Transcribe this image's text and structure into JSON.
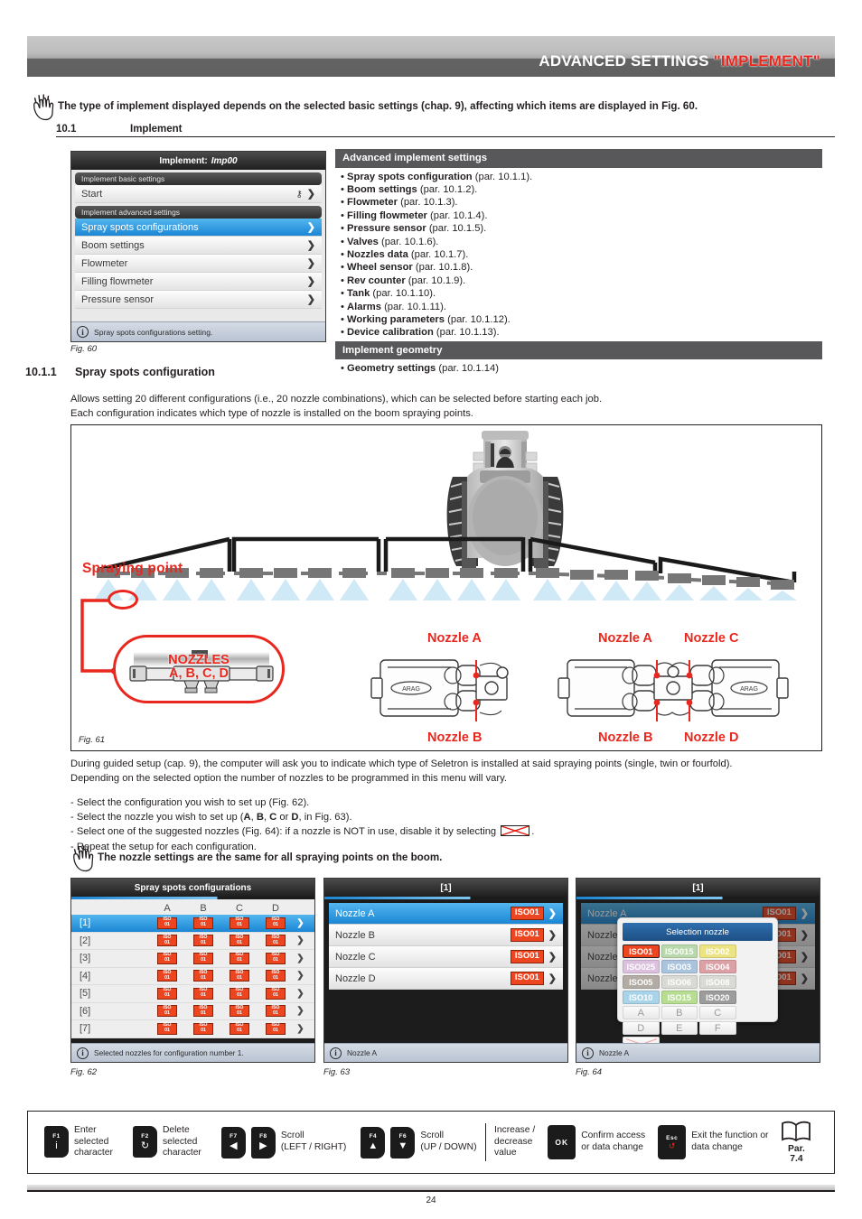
{
  "header": {
    "title_main": "ADVANCED SETTINGS ",
    "title_red": "\"IMPLEMENT\""
  },
  "note_top": "The type of implement displayed depends on the selected basic settings (chap. 9), affecting which items are displayed in Fig. 60.",
  "section_10_1": {
    "number": "10.1",
    "title": "Implement"
  },
  "section_10_1_1": {
    "number": "10.1.1",
    "title": "Spray spots configuration"
  },
  "intro": {
    "line1": "Allows setting 20 different configurations (i.e., 20 nozzle combinations), which can be selected before starting each job.",
    "line2": "Each configuration indicates which type of nozzle is installed on the boom spraying points."
  },
  "fig60": {
    "caption": "Fig. 60",
    "title_label": "Implement:",
    "title_value": "Imp00",
    "group1": "Implement basic settings",
    "start_row": "Start",
    "group2": "Implement advanced settings",
    "rows": [
      {
        "label": "Spray spots configurations",
        "selected": true
      },
      {
        "label": "Boom settings",
        "selected": false
      },
      {
        "label": "Flowmeter",
        "selected": false
      },
      {
        "label": "Filling flowmeter",
        "selected": false
      },
      {
        "label": "Pressure sensor",
        "selected": false
      }
    ],
    "info": "Spray spots configurations setting."
  },
  "advanced_panel": {
    "header": "Advanced implement settings",
    "items": [
      {
        "name": "Spray spots configuration",
        "par": " (par. 10.1.1)."
      },
      {
        "name": "Boom settings",
        "par": " (par. 10.1.2)."
      },
      {
        "name": "Flowmeter",
        "par": " (par. 10.1.3)."
      },
      {
        "name": "Filling flowmeter",
        "par": " (par. 10.1.4)."
      },
      {
        "name": "Pressure sensor",
        "par": " (par. 10.1.5)."
      },
      {
        "name": "Valves",
        "par": " (par. 10.1.6)."
      },
      {
        "name": "Nozzles data",
        "par": " (par. 10.1.7)."
      },
      {
        "name": "Wheel sensor",
        "par": " (par. 10.1.8)."
      },
      {
        "name": "Rev counter",
        "par": " (par. 10.1.9)."
      },
      {
        "name": "Tank",
        "par": " (par. 10.1.10)."
      },
      {
        "name": "Alarms",
        "par": " (par. 10.1.11)."
      },
      {
        "name": "Working parameters",
        "par": " (par. 10.1.12)."
      },
      {
        "name": "Device calibration",
        "par": " (par. 10.1.13)."
      }
    ],
    "geometry_header": "Implement geometry",
    "geometry_items": [
      {
        "name": "Geometry settings",
        "par": " (par. 10.1.14)"
      }
    ]
  },
  "fig61": {
    "caption": "Fig. 61",
    "spraying_point_label": "Spraying point",
    "bubble_line1": "NOZZLES",
    "bubble_line2": "A, B, C, D",
    "labels": {
      "single_top": "Nozzle A",
      "single_bottom": "Nozzle B",
      "four_top_left": "Nozzle A",
      "four_bottom_left": "Nozzle B",
      "four_top_right": "Nozzle C",
      "four_bottom_right": "Nozzle D"
    }
  },
  "during": {
    "line1": "During guided setup (cap. 9), the computer will ask you to indicate which type of Seletron is installed at said spraying points (single, twin or fourfold).",
    "line2": "Depending on the selected option the number of nozzles to be programmed in this menu will vary."
  },
  "steps": {
    "s1": "- Select the configuration you wish to set up (Fig. 62).",
    "s2_a": "- Select the nozzle you wish to set up (",
    "s2_A": "A",
    "s2_c1": ", ",
    "s2_B": "B",
    "s2_c2": ", ",
    "s2_C": "C",
    "s2_or": " or ",
    "s2_D": "D",
    "s2_b": ", in Fig. 63).",
    "s3_a": "- Select one of the suggested nozzles (Fig. 64): if a nozzle is NOT in use, disable it by selecting ",
    "s3_b": ".",
    "s4": "- Repeat the setup for each configuration."
  },
  "note_bottom": "The nozzle settings are the same for all spraying points on the boom.",
  "fig62": {
    "caption": "Fig. 62",
    "title": "Spray spots configurations",
    "columns": [
      "A",
      "B",
      "C",
      "D"
    ],
    "chip_top": "ISO",
    "chip_bottom": "01",
    "rows": [
      {
        "label": "[1]",
        "selected": true,
        "values": [
          "ISO01",
          "ISO01",
          "ISO01",
          "ISO01"
        ]
      },
      {
        "label": "[2]",
        "selected": false,
        "values": [
          "ISO01",
          "ISO01",
          "ISO01",
          "ISO01"
        ]
      },
      {
        "label": "[3]",
        "selected": false,
        "values": [
          "ISO01",
          "ISO01",
          "ISO01",
          "ISO01"
        ]
      },
      {
        "label": "[4]",
        "selected": false,
        "values": [
          "ISO01",
          "ISO01",
          "ISO01",
          "ISO01"
        ]
      },
      {
        "label": "[5]",
        "selected": false,
        "values": [
          "ISO01",
          "ISO01",
          "ISO01",
          "ISO01"
        ]
      },
      {
        "label": "[6]",
        "selected": false,
        "values": [
          "ISO01",
          "ISO01",
          "ISO01",
          "ISO01"
        ]
      },
      {
        "label": "[7]",
        "selected": false,
        "values": [
          "ISO01",
          "ISO01",
          "ISO01",
          "ISO01"
        ]
      }
    ],
    "info": "Selected nozzles for configuration number 1."
  },
  "fig63": {
    "caption": "Fig. 63",
    "title": "[1]",
    "rows": [
      {
        "label": "Nozzle A",
        "value": "ISO01",
        "selected": true
      },
      {
        "label": "Nozzle B",
        "value": "ISO01",
        "selected": false
      },
      {
        "label": "Nozzle C",
        "value": "ISO01",
        "selected": false
      },
      {
        "label": "Nozzle D",
        "value": "ISO01",
        "selected": false
      }
    ],
    "info": "Nozzle A"
  },
  "fig64": {
    "caption": "Fig. 64",
    "title": "[1]",
    "rows": [
      {
        "label": "Nozzle A",
        "value": "ISO01",
        "selected": true
      },
      {
        "label": "Nozzle B",
        "value": "ISO01",
        "selected": false
      },
      {
        "label": "Nozzle C",
        "value": "ISO01",
        "selected": false
      },
      {
        "label": "Nozzle D",
        "value": "ISO01",
        "selected": false
      }
    ],
    "dialog_title": "Selection nozzle",
    "nozzle_chips": [
      {
        "label": "ISO01",
        "bg": "#ee4521",
        "fg": "#ffffff",
        "selected": true
      },
      {
        "label": "ISO015",
        "bg": "#b9d9ac",
        "fg": "#ffffff",
        "selected": false
      },
      {
        "label": "ISO02",
        "bg": "#ece483",
        "fg": "#ffffff",
        "selected": false
      },
      {
        "label": "ISO025",
        "bg": "#dcc1de",
        "fg": "#ffffff",
        "selected": false
      },
      {
        "label": "ISO03",
        "bg": "#aac4dd",
        "fg": "#ffffff",
        "selected": false
      },
      {
        "label": "ISO04",
        "bg": "#dba1a6",
        "fg": "#ffffff",
        "selected": false
      },
      {
        "label": "ISO05",
        "bg": "#b3aca4",
        "fg": "#ffffff",
        "selected": false
      },
      {
        "label": "ISO06",
        "bg": "#d9d9d5",
        "fg": "#ffffff",
        "selected": false
      },
      {
        "label": "ISO08",
        "bg": "#d9d9d5",
        "fg": "#ffffff",
        "selected": false
      },
      {
        "label": "ISO10",
        "bg": "#a9d3e8",
        "fg": "#ffffff",
        "selected": false
      },
      {
        "label": "ISO15",
        "bg": "#b6dd92",
        "fg": "#ffffff",
        "selected": false
      },
      {
        "label": "ISO20",
        "bg": "#9c9c9c",
        "fg": "#ffffff",
        "selected": false
      }
    ],
    "letter_chips": [
      "A",
      "B",
      "C",
      "D",
      "E",
      "F"
    ],
    "disable_chip": "disabled-nozzle-x",
    "info": "Nozzle A"
  },
  "keys": [
    {
      "key": "F1",
      "glyph": "i",
      "lines": [
        "Enter",
        "selected",
        "character"
      ]
    },
    {
      "key": "F2",
      "glyph": "↻",
      "lines": [
        "Delete",
        "selected",
        "character"
      ]
    }
  ],
  "keys_scroll_lr": {
    "k1": "F7",
    "k2": "F8",
    "g1": "◀",
    "g2": "▶",
    "l1": "Scroll",
    "l2": "(LEFT / RIGHT)"
  },
  "keys_scroll_ud": {
    "k1": "F4",
    "k2": "F6",
    "g1": "▲",
    "g2": "▼",
    "l1": "Scroll",
    "l2": "(UP / DOWN)"
  },
  "increase": {
    "l1": "Increase /",
    "l2": "decrease",
    "l3": "value"
  },
  "okkey": {
    "label": "OK",
    "l1": "Confirm access",
    "l2": "or data change"
  },
  "esckey": {
    "top": "Esc",
    "bottom": "↺",
    "l1": "Exit the function or",
    "l2": "data change"
  },
  "bookkey": {
    "l1": "Par.",
    "l2": "7.4"
  },
  "footer": {
    "page": "24"
  }
}
